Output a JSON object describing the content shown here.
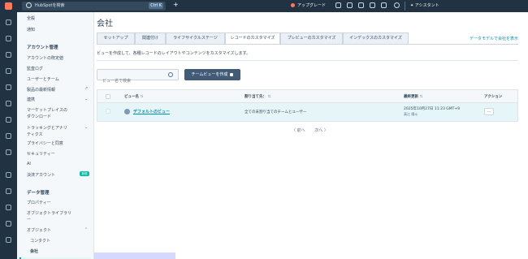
{
  "topbar": {
    "search_placeholder": "HubSpotを検索",
    "search_shortcut": "Ctrl K",
    "add_label": "+",
    "upgrade_label": "アップグレード",
    "assistant_label": "✦ アシスタント"
  },
  "sidebar": {
    "items": [
      {
        "label": "全般"
      },
      {
        "label": "通知"
      },
      {
        "label": "アカウント管理",
        "heading": true
      },
      {
        "label": "アカウントの既定値"
      },
      {
        "label": "監査ログ"
      },
      {
        "label": "ユーザーとチーム"
      },
      {
        "label": "製品の最新情報"
      },
      {
        "label": "連携"
      },
      {
        "label": "マーケットプレイスの"
      },
      {
        "label": "ダウンロード"
      },
      {
        "label": "トラッキングとアナリ"
      },
      {
        "label": "ティクス"
      },
      {
        "label": "プライバシーと同意"
      },
      {
        "label": "セキュリティー"
      },
      {
        "label": "AI"
      },
      {
        "label": "決済アカウント"
      },
      {
        "label": "データ管理",
        "heading": true
      },
      {
        "label": "プロパティー"
      },
      {
        "label": "オブジェクトライブラリ"
      },
      {
        "label": "ー"
      },
      {
        "label": "オブジェクト"
      },
      {
        "label": "コンタクト"
      },
      {
        "label": "会社"
      }
    ],
    "new_badge": "新規"
  },
  "main": {
    "title": "会社",
    "tabs": [
      {
        "label": "セットアップ"
      },
      {
        "label": "関連付け"
      },
      {
        "label": "ライフサイクルステージ"
      },
      {
        "label": "レコードのカスタマイズ"
      },
      {
        "label": "プレビューのカスタマイズ"
      },
      {
        "label": "インデックスのカスタマイズ"
      }
    ],
    "active_tab": "レコードのカスタマイズ",
    "help_link": "データモデルで会社を表示",
    "description": "ビューを作成して、各種レコードのレイアウトやコンテンツをカスタマイズします。",
    "search_placeholder": "ビュー名で検索",
    "create_button": "チームビューを作成"
  },
  "table": {
    "columns": [
      "ビュー名",
      "割り当て先：",
      "最終更新",
      "アクション"
    ],
    "rows": [
      {
        "name": "デフォルトのビュー",
        "assigned": "全ての未割り当てのチームとユーザー",
        "updated": "2025年10月27日 11:23 GMT+9",
        "updated_by": "高江 陽斗",
        "action": "…"
      }
    ]
  },
  "pager": {
    "prev": "〈 前へ",
    "next": "次へ 〉"
  },
  "colors": {
    "topbar": "#213343",
    "accent": "#0091ae",
    "brand": "#ff7a59",
    "button": "#425b76",
    "selected_row": "#e5f5f8"
  }
}
